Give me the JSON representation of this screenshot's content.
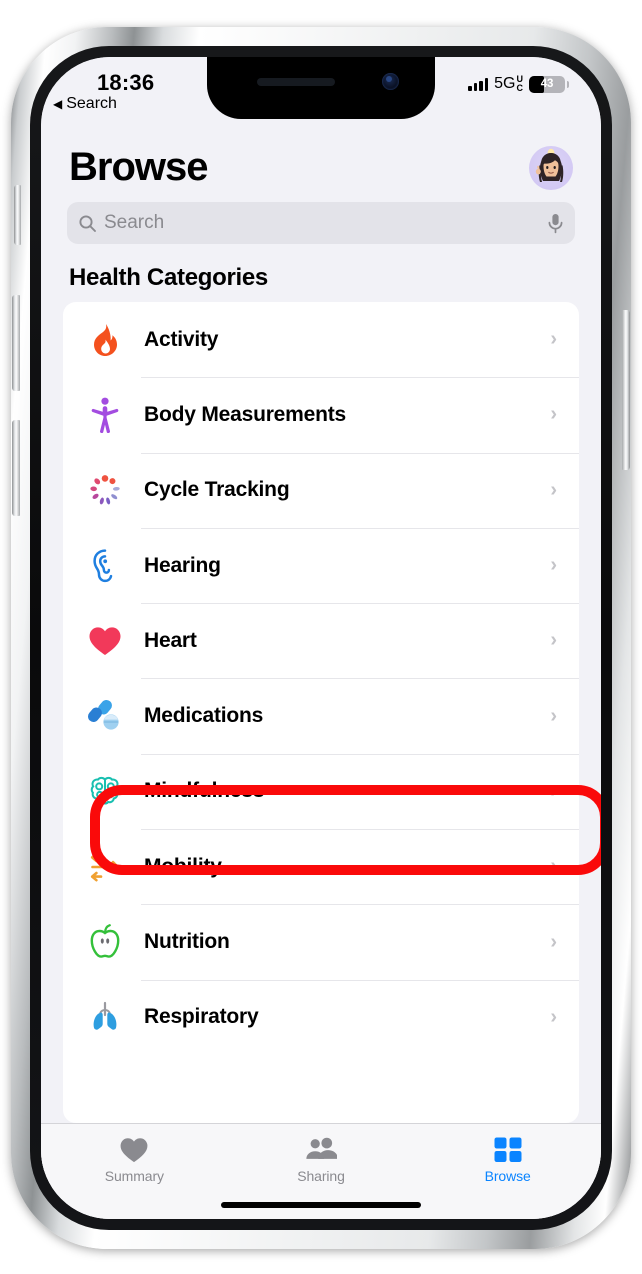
{
  "status_bar": {
    "time": "18:36",
    "back_label": "Search",
    "back_caret": "◀",
    "network": "5G",
    "network_sup_top": "U",
    "network_sup_bottom": "C",
    "battery_level": "43"
  },
  "header": {
    "title": "Browse",
    "avatar_name": "memoji-avatar"
  },
  "search": {
    "placeholder": "Search",
    "search_icon": "search-icon",
    "mic_icon": "microphone-icon"
  },
  "section": {
    "title": "Health Categories"
  },
  "categories": [
    {
      "label": "Activity",
      "icon": "flame-icon",
      "color": "#f4511e",
      "chevron": "›"
    },
    {
      "label": "Body Measurements",
      "icon": "body-figure-icon",
      "color": "#a34ce0",
      "chevron": "›"
    },
    {
      "label": "Cycle Tracking",
      "icon": "cycle-dots-icon",
      "color": "#e8503a",
      "chevron": "›"
    },
    {
      "label": "Hearing",
      "icon": "ear-icon",
      "color": "#1f7fe0",
      "chevron": "›"
    },
    {
      "label": "Heart",
      "icon": "heart-icon",
      "color": "#f2395a",
      "chevron": "›"
    },
    {
      "label": "Medications",
      "icon": "pills-icon",
      "color": "#3aa3e8",
      "chevron": "›"
    },
    {
      "label": "Mindfulness",
      "icon": "brain-icon",
      "color": "#19bfb0",
      "chevron": "›"
    },
    {
      "label": "Mobility",
      "icon": "arrows-icon",
      "color": "#f0a030",
      "chevron": "›"
    },
    {
      "label": "Nutrition",
      "icon": "apple-icon",
      "color": "#34c03a",
      "chevron": "›"
    },
    {
      "label": "Respiratory",
      "icon": "lungs-icon",
      "color": "#2e9ee0",
      "chevron": "›"
    }
  ],
  "highlight": {
    "target_label": "Medications",
    "color": "#fa0a0a"
  },
  "tab_bar": [
    {
      "label": "Summary",
      "icon": "heart-icon",
      "active": false
    },
    {
      "label": "Sharing",
      "icon": "people-icon",
      "active": false
    },
    {
      "label": "Browse",
      "icon": "grid-icon",
      "active": true
    }
  ],
  "theme": {
    "background": "#f2f2f7",
    "card": "#ffffff",
    "accent": "#0a84ff",
    "separator": "#e6e6ea"
  }
}
